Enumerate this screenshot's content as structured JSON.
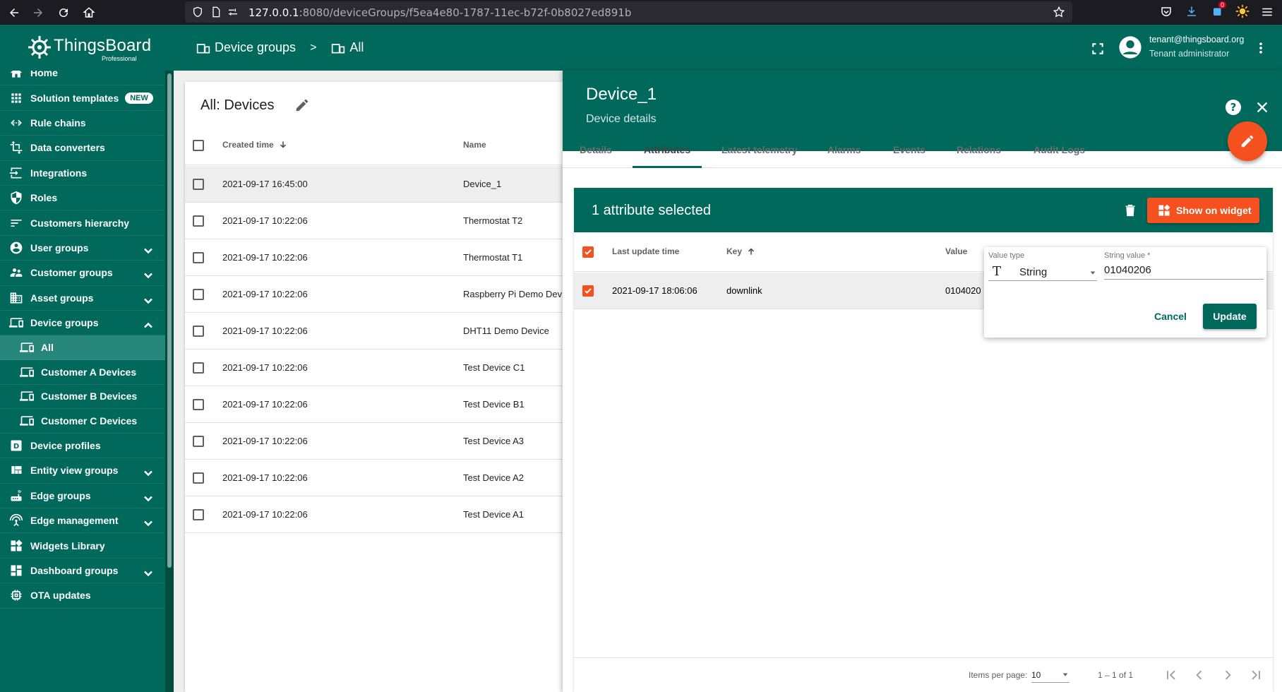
{
  "browser": {
    "url_host": "127.0.0.1",
    "url_rest": ":8080/deviceGroups/f5ea4e80-1787-11ec-b72f-0b8027ed891b",
    "badge_count": "0"
  },
  "header": {
    "logo_name": "ThingsBoard",
    "logo_sub": "Professional",
    "breadcrumb": [
      {
        "label": "Device groups",
        "icon": "devices-icon"
      },
      {
        "label": "All",
        "icon": "devices-icon"
      }
    ],
    "breadcrumb_sep": ">",
    "user_email": "tenant@thingsboard.org",
    "user_role": "Tenant administrator"
  },
  "sidebar": {
    "items": [
      {
        "label": "Home",
        "icon": "home-icon"
      },
      {
        "label": "Solution templates",
        "icon": "apps-icon",
        "badge": "NEW"
      },
      {
        "label": "Rule chains",
        "icon": "settings-ethernet-icon"
      },
      {
        "label": "Data converters",
        "icon": "transform-icon"
      },
      {
        "label": "Integrations",
        "icon": "input-icon"
      },
      {
        "label": "Roles",
        "icon": "security-icon"
      },
      {
        "label": "Customers hierarchy",
        "icon": "sort-icon"
      },
      {
        "label": "User groups",
        "icon": "account-circle-icon",
        "expand": "down"
      },
      {
        "label": "Customer groups",
        "icon": "supervisor-account-icon",
        "expand": "down"
      },
      {
        "label": "Asset groups",
        "icon": "domain-icon",
        "expand": "down"
      },
      {
        "label": "Device groups",
        "icon": "devices-icon",
        "expand": "up"
      },
      {
        "label": "All",
        "icon": "devices-icon",
        "sub": true,
        "active": true
      },
      {
        "label": "Customer A Devices",
        "icon": "devices-icon",
        "sub": true
      },
      {
        "label": "Customer B Devices",
        "icon": "devices-icon",
        "sub": true
      },
      {
        "label": "Customer C Devices",
        "icon": "devices-icon",
        "sub": true
      },
      {
        "label": "Device profiles",
        "icon": "device-profile-icon"
      },
      {
        "label": "Entity view groups",
        "icon": "view-quilt-icon",
        "expand": "down"
      },
      {
        "label": "Edge groups",
        "icon": "router-icon",
        "expand": "down"
      },
      {
        "label": "Edge management",
        "icon": "settings-input-antenna-icon",
        "expand": "down"
      },
      {
        "label": "Widgets Library",
        "icon": "widgets-icon"
      },
      {
        "label": "Dashboard groups",
        "icon": "dashboard-icon",
        "expand": "down"
      },
      {
        "label": "OTA updates",
        "icon": "memory-icon"
      }
    ]
  },
  "devices_card": {
    "title": "All: Devices",
    "col_created": "Created time",
    "col_name": "Name",
    "rows": [
      {
        "created": "2021-09-17 16:45:00",
        "name": "Device_1",
        "selected": true
      },
      {
        "created": "2021-09-17 10:22:06",
        "name": "Thermostat T2"
      },
      {
        "created": "2021-09-17 10:22:06",
        "name": "Thermostat T1"
      },
      {
        "created": "2021-09-17 10:22:06",
        "name": "Raspberry Pi Demo Devi"
      },
      {
        "created": "2021-09-17 10:22:06",
        "name": "DHT11 Demo Device"
      },
      {
        "created": "2021-09-17 10:22:06",
        "name": "Test Device C1"
      },
      {
        "created": "2021-09-17 10:22:06",
        "name": "Test Device B1"
      },
      {
        "created": "2021-09-17 10:22:06",
        "name": "Test Device A3"
      },
      {
        "created": "2021-09-17 10:22:06",
        "name": "Test Device A2"
      },
      {
        "created": "2021-09-17 10:22:06",
        "name": "Test Device A1"
      }
    ]
  },
  "details": {
    "title": "Device_1",
    "subtitle": "Device details",
    "tabs": [
      "Details",
      "Attributes",
      "Latest telemetry",
      "Alarms",
      "Events",
      "Relations",
      "Audit Logs"
    ],
    "active_tab": 1,
    "selection_text": "1 attribute selected",
    "show_widget_label": "Show on widget",
    "col_last_update": "Last update time",
    "col_key": "Key",
    "col_value": "Value",
    "attr_row": {
      "time": "2021-09-17 18:06:06",
      "key": "downlink",
      "value": "0104020"
    },
    "popup": {
      "value_type_label": "Value type",
      "value_type": "String",
      "value_type_icon": "T",
      "string_label": "String value *",
      "string_value": "01040206",
      "cancel": "Cancel",
      "update": "Update"
    },
    "pager": {
      "items_per_page_label": "Items per page:",
      "items_per_page": "10",
      "range": "1 – 1 of 1"
    }
  },
  "colors": {
    "primary": "#00695c",
    "accent": "#f4511e"
  }
}
